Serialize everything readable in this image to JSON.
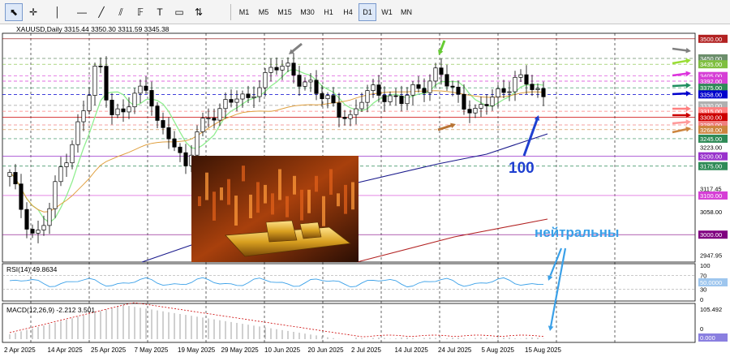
{
  "toolbar": {
    "tools": [
      {
        "name": "cursor-icon"
      },
      {
        "name": "crosshair-icon"
      },
      {
        "name": "vertical-line-icon"
      },
      {
        "name": "horizontal-line-icon"
      },
      {
        "name": "trendline-icon"
      },
      {
        "name": "equidistant-channel-icon"
      },
      {
        "name": "fibonacci-icon"
      },
      {
        "name": "text-icon"
      },
      {
        "name": "text-label-icon"
      },
      {
        "name": "arrows-icon"
      }
    ],
    "timeframes": [
      "M1",
      "M5",
      "M15",
      "M30",
      "H1",
      "H4",
      "D1",
      "W1",
      "MN"
    ],
    "active_timeframe": "D1"
  },
  "chart": {
    "header": "XAUUSD,Daily  3315.44 3350.30 3311.59 3345.38",
    "price_labels": [
      {
        "text": "3500.00",
        "value": 3500,
        "color": "#b22222",
        "line": "#8b0000"
      },
      {
        "text": "3450.00",
        "value": 3450,
        "color": "#6b8e6b",
        "line": "#6b8e6b"
      },
      {
        "text": "3435.00",
        "value": 3435,
        "color": "#7fbf3f",
        "line": "#7fbf3f"
      },
      {
        "text": "3405.00",
        "value": 3405,
        "color": "#d63fd6",
        "line": "#d63fd6"
      },
      {
        "text": "3392.00",
        "value": 3392,
        "color": "#d63fd6",
        "line": "#d63fd6"
      },
      {
        "text": "3375.00",
        "value": 3375,
        "color": "#2e8b57",
        "line": "#2e8b57"
      },
      {
        "text": "3358.00",
        "value": 3358,
        "color": "#0000cd",
        "line": "#0000cd"
      },
      {
        "text": "3330.00",
        "value": 3330,
        "color": "#b0b0b0",
        "line": "#a0a0a0"
      },
      {
        "text": "3315.00",
        "value": 3315,
        "color": "#ff7f7f",
        "line": "#ff7f7f"
      },
      {
        "text": "3300.00",
        "value": 3300,
        "color": "#cc0000",
        "line": "#cc0000"
      },
      {
        "text": "3280.00",
        "value": 3280,
        "color": "#f08080",
        "line": "#f08080"
      },
      {
        "text": "3268.00",
        "value": 3268,
        "color": "#cd853f",
        "line": "#cd853f"
      },
      {
        "text": "3245.00",
        "value": 3245,
        "color": "#2e8b57",
        "line": "#2e8b57"
      },
      {
        "text": "3200.00",
        "value": 3200,
        "color": "#9932cc",
        "line": "#9932cc"
      },
      {
        "text": "3175.00",
        "value": 3175,
        "color": "#2e8b57",
        "line": "#2e8b57"
      },
      {
        "text": "3100.00",
        "value": 3100,
        "color": "#d63fd6",
        "line": "#d63fd6"
      },
      {
        "text": "3000.00",
        "value": 3000,
        "color": "#800080",
        "line": "#800080"
      }
    ],
    "axis_ticks": [
      {
        "text": "3223.00",
        "value": 3223
      },
      {
        "text": "3117.45",
        "value": 3117.45
      },
      {
        "text": "3058.00",
        "value": 3058
      },
      {
        "text": "2947.95",
        "value": 2947.95
      }
    ],
    "price_range": [
      2930,
      3510
    ],
    "annotation_100": "100",
    "annotation_neutral": "нейтральны",
    "rsi": {
      "header": "RSI(14) 49.8634",
      "ticks": [
        "100",
        "70",
        "30",
        "0"
      ],
      "current": "50.0000"
    },
    "macd": {
      "header": "MACD(12,26,9) -2.212 3.501",
      "ticks": [
        "105.492",
        "0"
      ],
      "current": "0.000"
    },
    "dates": [
      "2 Apr 2025",
      "14 Apr 2025",
      "25 Apr 2025",
      "7 May 2025",
      "19 May 2025",
      "29 May 2025",
      "10 Jun 2025",
      "20 Jun 2025",
      "2 Jul 2025",
      "14 Jul 2025",
      "24 Jul 2025",
      "5 Aug 2025",
      "15 Aug 2025"
    ],
    "image_name": "gold-bars-image",
    "colors": {
      "bull": "#ffffff",
      "bear": "#000000",
      "ma_fast": "#90ee90",
      "ma_mid": "#e0a040",
      "ma_slow": "#1a1a8c",
      "ma_long": "#b22222",
      "annotation_blue": "#1e90ff"
    }
  },
  "chart_data": {
    "type": "candlestick",
    "title": "XAUUSD,Daily",
    "ohlc_last": {
      "open": 3315.44,
      "high": 3350.3,
      "low": 3311.59,
      "close": 3345.38
    },
    "x": [
      "2 Apr 2025",
      "14 Apr 2025",
      "25 Apr 2025",
      "7 May 2025",
      "19 May 2025",
      "29 May 2025",
      "10 Jun 2025",
      "20 Jun 2025",
      "2 Jul 2025",
      "14 Jul 2025",
      "24 Jul 2025",
      "5 Aug 2025",
      "15 Aug 2025"
    ],
    "closes": [
      3110,
      3245,
      3318,
      3305,
      3240,
      3300,
      3380,
      3370,
      3350,
      3345,
      3380,
      3390,
      3350
    ],
    "ylim": [
      2930,
      3510
    ],
    "indicators": [
      {
        "name": "RSI(14)",
        "last": 49.8634
      },
      {
        "name": "MACD(12,26,9)",
        "values": [
          -2.212,
          3.501
        ]
      }
    ]
  }
}
